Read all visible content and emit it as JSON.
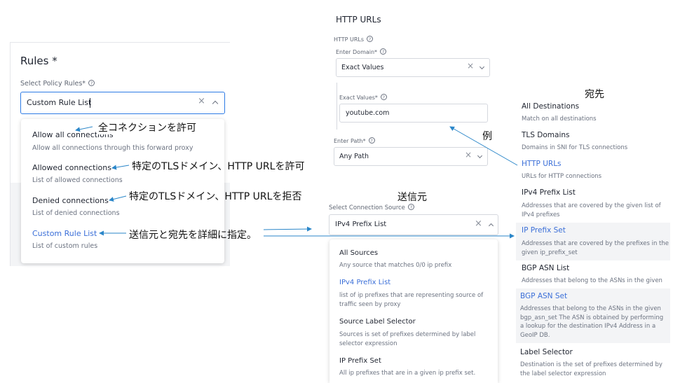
{
  "rules": {
    "title": "Rules *",
    "policy_label": "Select Policy Rules*",
    "help": "?",
    "selected_value": "Custom Rule List",
    "clear": "×",
    "options": [
      {
        "title": "Allow all connections",
        "desc": "Allow all connections through this forward proxy"
      },
      {
        "title": "Allowed connections",
        "desc": "List of allowed connections"
      },
      {
        "title": "Denied connections",
        "desc": "List of denied connections"
      },
      {
        "title": "Custom Rule List",
        "desc": "List of custom rules"
      }
    ]
  },
  "annotations": {
    "allow_all": "全コネクションを許可",
    "allowed": "特定のTLSドメイン、HTTP URLを許可",
    "denied": "特定のTLSドメイン、HTTP URLを拒否",
    "custom": "送信元と宛先を詳細に指定。",
    "source": "送信元",
    "destination": "宛先",
    "example": "例"
  },
  "http_urls": {
    "heading": "HTTP URLs",
    "small_label": "HTTP URLs",
    "domain_label": "Enter Domain*",
    "domain_value": "Exact Values",
    "exact_label": "Exact Values*",
    "exact_value": "youtube.com",
    "path_label": "Enter Path*",
    "path_value": "Any Path"
  },
  "source": {
    "label": "Select Connection Source",
    "selected_value": "IPv4 Prefix List",
    "options": [
      {
        "title": "All Sources",
        "desc": "Any source that matches 0/0 ip prefix"
      },
      {
        "title": "IPv4 Prefix List",
        "desc": "list of ip prefixes that are representing source of traffic seen by proxy"
      },
      {
        "title": "Source Label Selector",
        "desc": "Sources is set of prefixes determined by label selector expression"
      },
      {
        "title": "IP Prefix Set",
        "desc": "All ip prefixes that are in a given ip prefix set."
      }
    ]
  },
  "destinations": [
    {
      "title": "All Destinations",
      "desc": "Match on all destinations"
    },
    {
      "title": "TLS Domains",
      "desc": "Domains in SNI for TLS connections"
    },
    {
      "title": "HTTP URLs",
      "desc": "URLs for HTTP connections"
    },
    {
      "title": "IPv4 Prefix List",
      "desc": "Addresses that are covered by the given list of IPv4 prefixes"
    },
    {
      "title": "IP Prefix Set",
      "desc": "Addresses that are covered by the prefixes in the given ip_prefix_set"
    },
    {
      "title": "BGP ASN List",
      "desc": "Addresses that belong to the ASNs in the given"
    },
    {
      "title": "BGP ASN Set",
      "desc": "Addresses that belong to the ASNs in the given bgp_asn_set The ASN is obtained by performing a lookup for the destination IPv4 Address in a GeoIP DB."
    },
    {
      "title": "Label Selector",
      "desc": "Destination is the set of prefixes determined by the label selector expression"
    }
  ],
  "colors": {
    "accent": "#3b6fd8",
    "focus_border": "#2d7be5",
    "arrow": "#2a86c9"
  }
}
